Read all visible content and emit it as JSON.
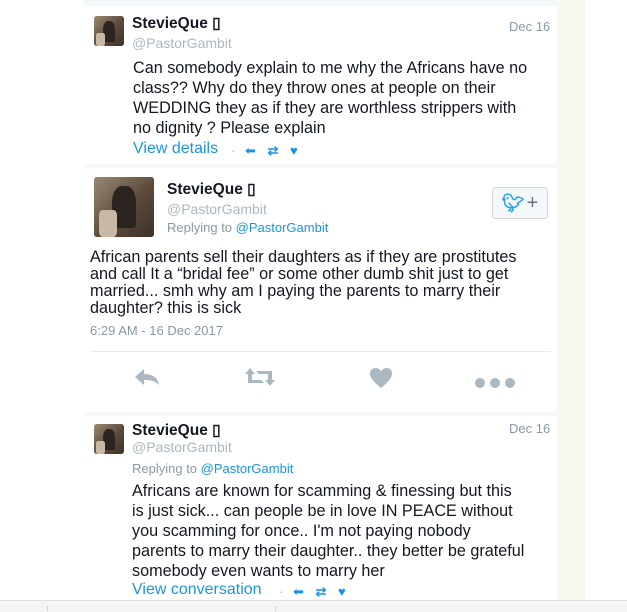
{
  "tweet1": {
    "name": "StevieQue ▯",
    "handle": "@PastorGambit",
    "date": "Dec 16",
    "lines": [
      "Can somebody explain to me why the Africans have no",
      "class?? Why do they throw ones at people on their",
      "WEDDING they as if they are worthless strippers with",
      "no dignity ? Please explain"
    ],
    "link": "View details",
    "link_sep": "·",
    "icons": "⬅ ⇄ ♥"
  },
  "tweet2": {
    "name": "StevieQue ▯",
    "handle": "@PastorGambit",
    "reply_prefix": "Replying to ",
    "reply_handle": "@PastorGambit",
    "lines": [
      "African parents sell their daughters as if they are prostitutes",
      "and call It a “bridal fee” or some other dumb shit just to get",
      "married... smh why am I paying the parents to marry their",
      "daughter? this is sick"
    ],
    "timestamp": "6:29 AM - 16 Dec 2017",
    "follow_plus": "+"
  },
  "tweet3": {
    "name": "StevieQue ▯",
    "handle": "@PastorGambit",
    "date": "Dec 16",
    "reply_prefix": "Replying to ",
    "reply_handle": "@PastorGambit",
    "lines": [
      "Africans are known for scamming & finessing but this",
      "is just sick... can people be in love IN PEACE without",
      "you scamming for once.. I'm not paying nobody",
      "parents to marry their daughter.. they better be grateful",
      "somebody even wants to marry her"
    ],
    "link": "View conversation",
    "link_sep": "·",
    "icons": "⬅ ⇄ ♥"
  },
  "colors": {
    "link_blue": "#1b95e0",
    "twitter_blue": "#1da1f2",
    "gray_text": "#8899a6",
    "action_gray": "#aab8c2"
  }
}
